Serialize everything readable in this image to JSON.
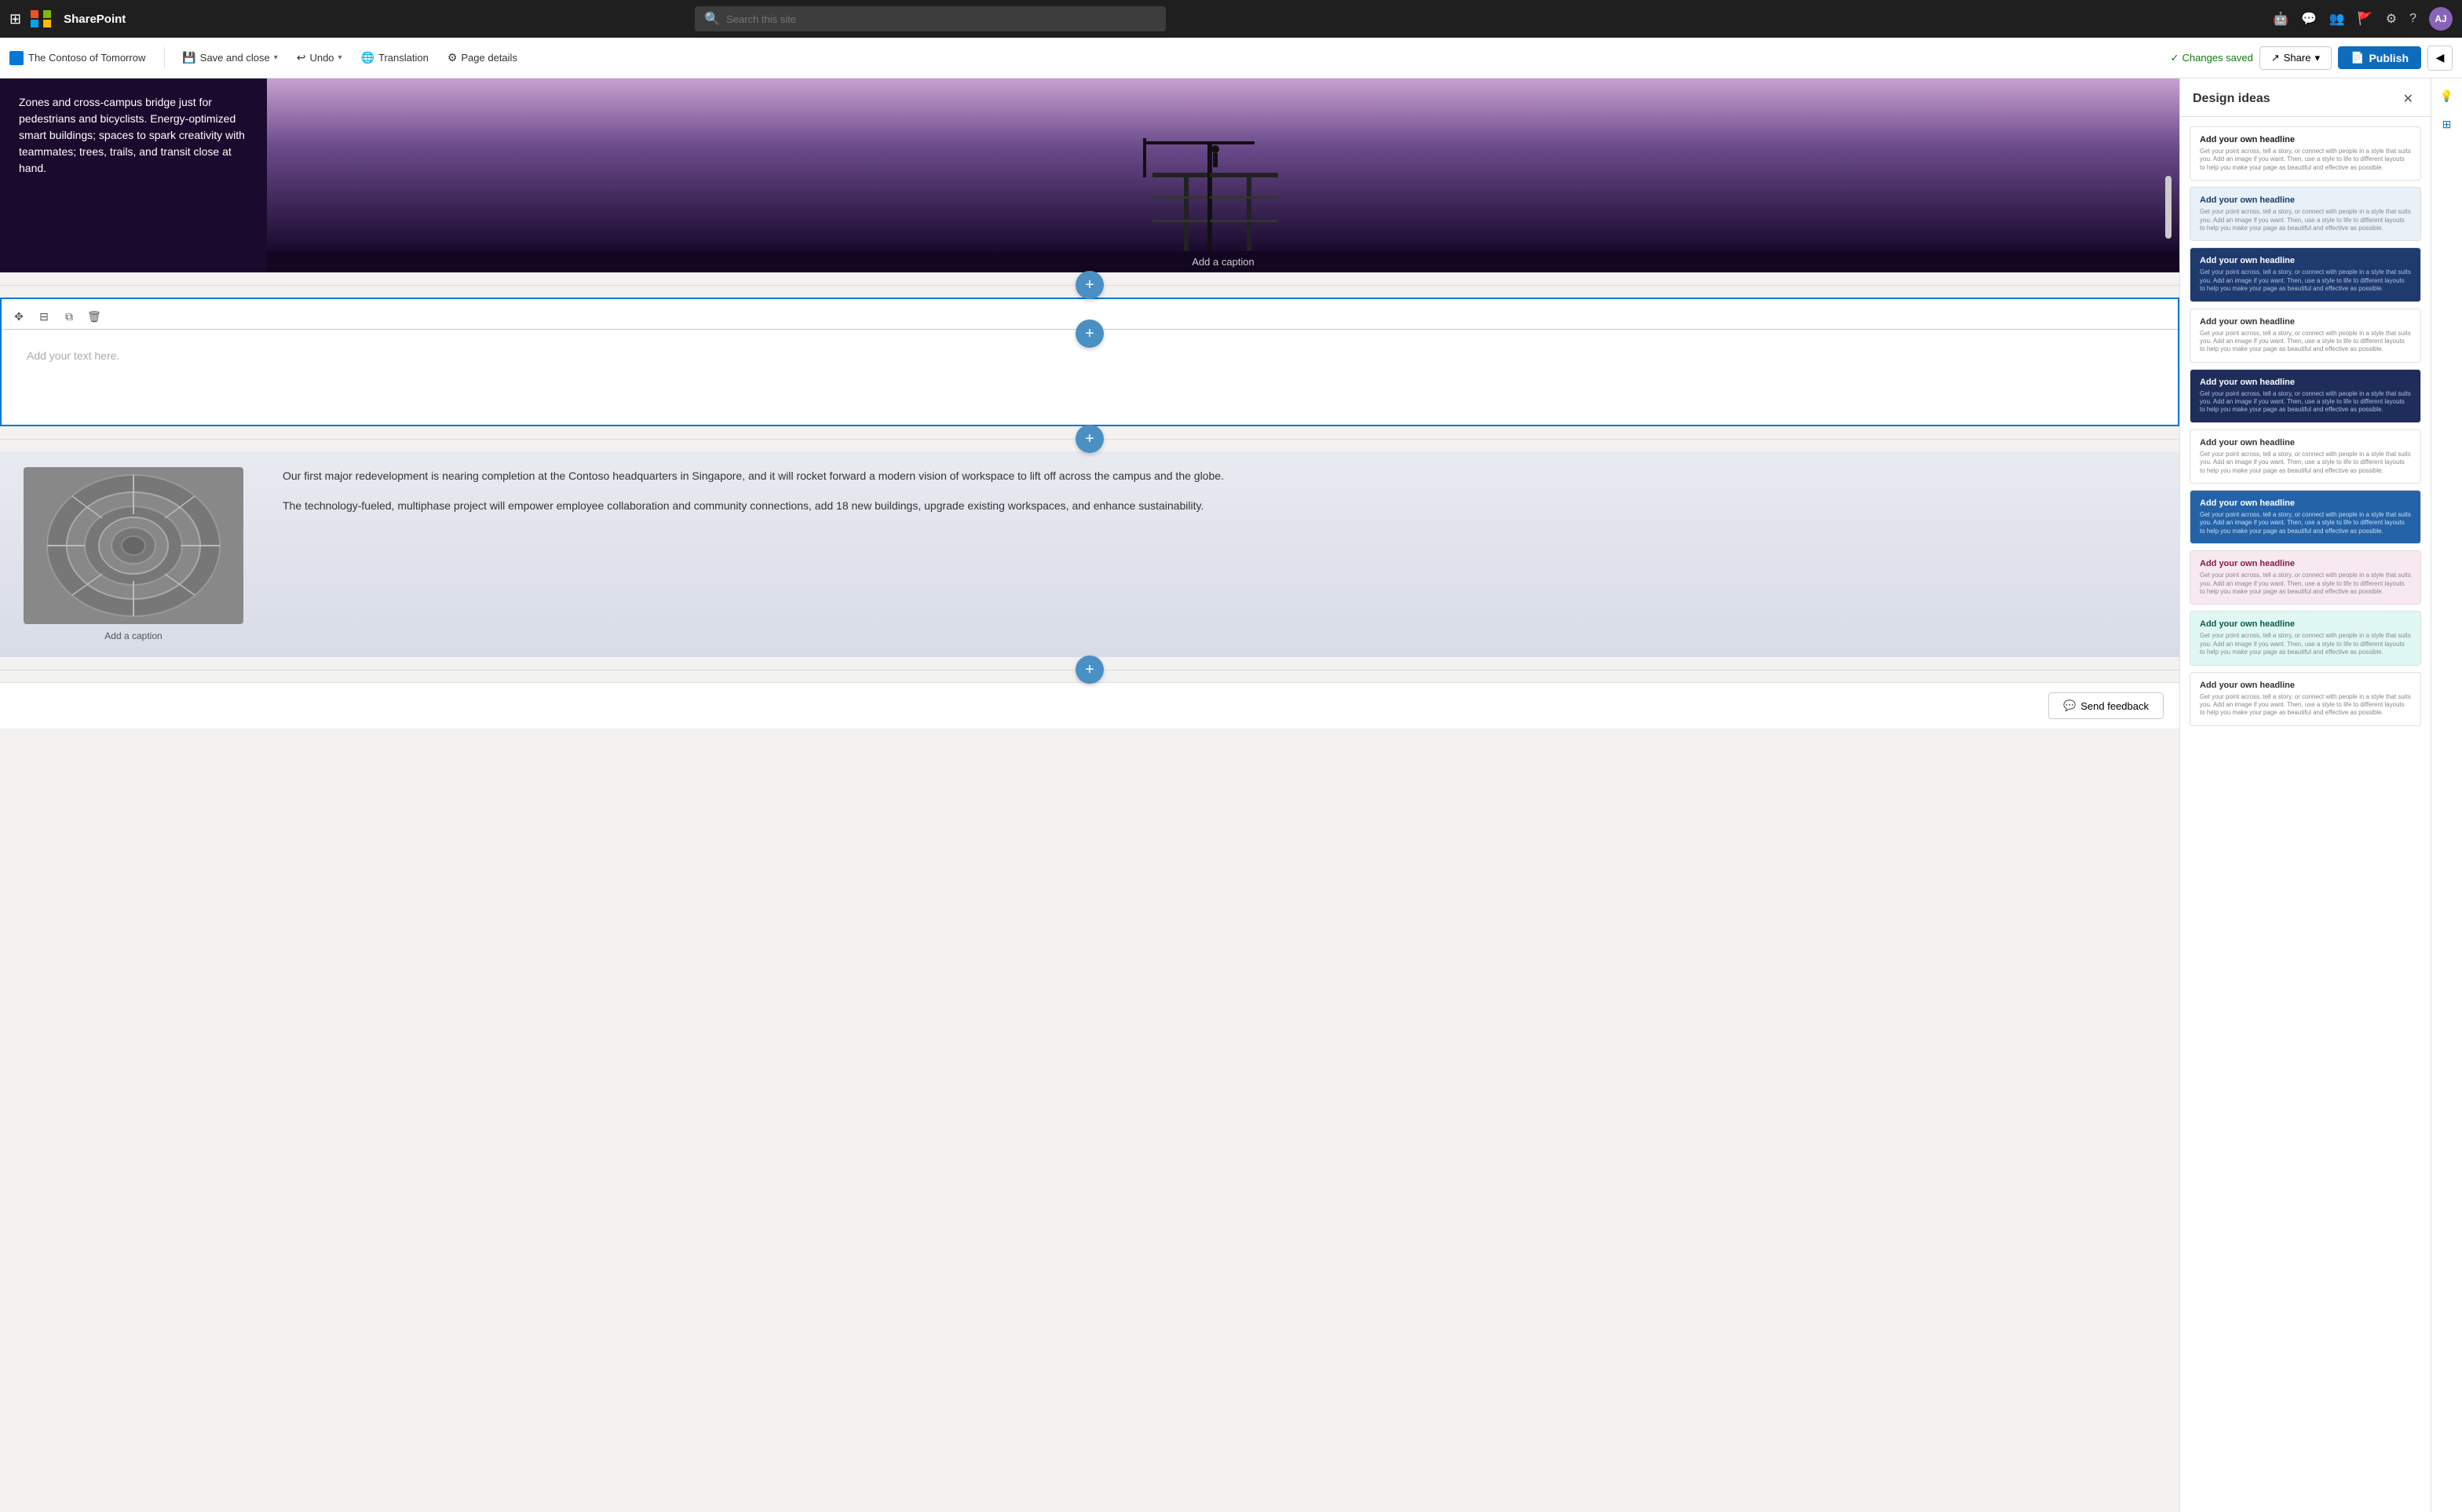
{
  "topNav": {
    "appName": "SharePoint",
    "searchPlaceholder": "Search this site",
    "avatarInitials": "AJ"
  },
  "toolbar": {
    "breadcrumbTitle": "The Contoso of Tomorrow",
    "saveAndClose": "Save and close",
    "undo": "Undo",
    "translation": "Translation",
    "pageDetails": "Page details",
    "changesSaved": "Changes saved",
    "share": "Share",
    "publish": "Publish"
  },
  "textEditor": {
    "placeholder": "Add your text here."
  },
  "captions": {
    "topImage": "Add a caption",
    "bottomImage": "Add a caption"
  },
  "bottomText": {
    "paragraph1": "Our first major redevelopment is nearing completion at the Contoso headquarters in Singapore, and it will rocket forward a modern vision of workspace to lift off across the campus and the globe.",
    "paragraph2": "The technology-fueled, multiphase project will empower employee collaboration and community connections, add 18 new buildings, upgrade existing workspaces, and enhance sustainability."
  },
  "topText": "Zones and cross-campus bridge just for pedestrians and bicyclists. Energy-optimized smart buildings; spaces to spark creativity with teammates; trees, trails, and transit close at hand.",
  "designIdeas": {
    "title": "Design ideas",
    "cards": [
      {
        "id": 1,
        "colorClass": "card-white",
        "headline": "Add your own headline",
        "subtext": "Get your point across, tell a story, or connect with people in a style that suits you. Add an image if you want. Then, use a style to life to different layouts to help you make your page as beautiful and effective as possible."
      },
      {
        "id": 2,
        "colorClass": "card-light-blue",
        "headline": "Add your own headline",
        "subtext": "Get your point across, tell a story, or connect with people in a style that suits you. Add an image if you want. Then, use a style to life to different layouts to help you make your page as beautiful and effective as possible."
      },
      {
        "id": 3,
        "colorClass": "card-dark-blue",
        "headline": "Add your own headline",
        "subtext": "Get your point across, tell a story, or connect with people in a style that suits you. Add an image if you want. Then, use a style to life to different layouts to help you make your page as beautiful and effective as possible."
      },
      {
        "id": 4,
        "colorClass": "card-medium-blue",
        "headline": "Add your own headline",
        "subtext": "Get your point across, tell a story, or connect with people in a style that suits you. Add an image if you want. Then, use a style to life to different layouts to help you make your page as beautiful and effective as possible."
      },
      {
        "id": 5,
        "colorClass": "card-navy",
        "headline": "Add your own headline",
        "subtext": "Get your point across, tell a story, or connect with people in a style that suits you. Add an image if you want. Then, use a style to life to different layouts to help you make your page as beautiful and effective as possible."
      },
      {
        "id": 6,
        "colorClass": "card-plain2",
        "headline": "Add your own headline",
        "subtext": "Get your point across, tell a story, or connect with people in a style that suits you. Add an image if you want. Then, use a style to life to different layouts to help you make your page as beautiful and effective as possible."
      },
      {
        "id": 7,
        "colorClass": "card-blue2",
        "headline": "Add your own headline",
        "subtext": "Get your point across, tell a story, or connect with people in a style that suits you. Add an image if you want. Then, use a style to life to different layouts to help you make your page as beautiful and effective as possible."
      },
      {
        "id": 8,
        "colorClass": "card-pink",
        "headline": "Add your own headline",
        "subtext": "Get your point across, tell a story, or connect with people in a style that suits you. Add an image if you want. Then, use a style to life to different layouts to help you make your page as beautiful and effective as possible."
      },
      {
        "id": 9,
        "colorClass": "card-teal",
        "headline": "Add your own headline",
        "subtext": "Get your point across, tell a story, or connect with people in a style that suits you. Add an image if you want. Then, use a style to life to different layouts to help you make your page as beautiful and effective as possible."
      },
      {
        "id": 10,
        "colorClass": "card-plain3",
        "headline": "Add your own headline",
        "subtext": "Get your point across, tell a story, or connect with people in a style that suits you. Add an image if you want. Then, use a style to life to different layouts to help you make your page as beautiful and effective as possible."
      }
    ]
  },
  "feedback": {
    "buttonLabel": "Send feedback"
  }
}
